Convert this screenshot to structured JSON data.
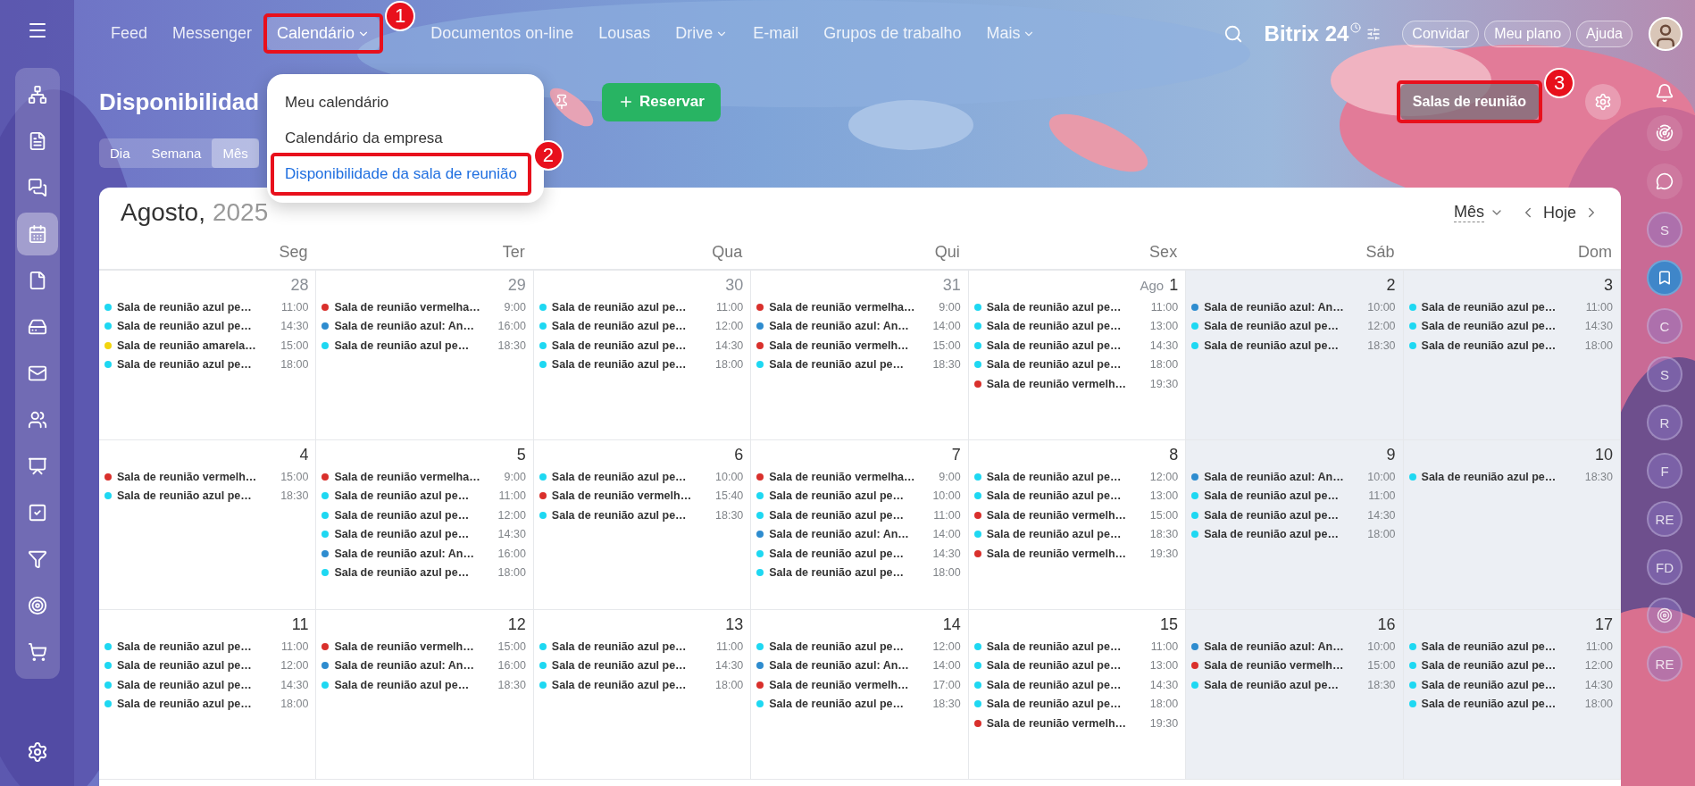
{
  "top_nav": {
    "items": [
      {
        "label": "Feed",
        "selected": false,
        "has_caret": false
      },
      {
        "label": "Messenger",
        "selected": false,
        "has_caret": false
      },
      {
        "label": "Calendário",
        "selected": true,
        "has_caret": true,
        "annotation": "1"
      },
      {
        "label": "Documentos on-line",
        "selected": false,
        "has_caret": false
      },
      {
        "label": "Lousas",
        "selected": false,
        "has_caret": false
      },
      {
        "label": "Drive",
        "selected": false,
        "has_caret": true
      },
      {
        "label": "E-mail",
        "selected": false,
        "has_caret": false
      },
      {
        "label": "Grupos de trabalho",
        "selected": false,
        "has_caret": false
      },
      {
        "label": "Mais",
        "selected": false,
        "has_caret": true
      }
    ],
    "logo": "Bitrix 24",
    "buttons": [
      "Convidar",
      "Meu plano",
      "Ajuda"
    ]
  },
  "dropdown": {
    "items": [
      {
        "label": "Meu calendário",
        "selected": false
      },
      {
        "label": "Calendário da empresa",
        "selected": false
      },
      {
        "label": "Disponibilidade da sala de reunião",
        "selected": true,
        "annotation": "2"
      }
    ]
  },
  "page": {
    "title": "Disponibilidad",
    "reserve_button": "Reservar",
    "rooms_button": {
      "label": "Salas de reunião",
      "annotation": "3"
    }
  },
  "view_tabs": [
    {
      "label": "Dia",
      "selected": false
    },
    {
      "label": "Semana",
      "selected": false
    },
    {
      "label": "Mês",
      "selected": true
    }
  ],
  "right_rail": [
    {
      "kind": "initials",
      "initials": "S"
    },
    {
      "kind": "bookmark"
    },
    {
      "kind": "initials",
      "initials": "C"
    },
    {
      "kind": "initials",
      "initials": "S"
    },
    {
      "kind": "initials",
      "initials": "R"
    },
    {
      "kind": "initials",
      "initials": "F"
    },
    {
      "kind": "initials",
      "initials": "RE"
    },
    {
      "kind": "initials",
      "initials": "FD"
    },
    {
      "kind": "target"
    },
    {
      "kind": "initials",
      "initials": "RE"
    }
  ],
  "calendar": {
    "month": "Agosto,",
    "year": "2025",
    "view_select": "Mês",
    "today": "Hoje",
    "weekdays": [
      {
        "label": "Seg",
        "weekend": false
      },
      {
        "label": "Ter",
        "weekend": false
      },
      {
        "label": "Qua",
        "weekend": false
      },
      {
        "label": "Qui",
        "weekend": false
      },
      {
        "label": "Sex",
        "weekend": false
      },
      {
        "label": "Sáb",
        "weekend": true
      },
      {
        "label": "Dom",
        "weekend": true
      }
    ],
    "weeks": [
      {
        "days": [
          {
            "day": "28",
            "other_month": true,
            "events": [
              {
                "title": "Sala de reunião azul pe…",
                "time": "11:00",
                "color": "#1ed8f2"
              },
              {
                "title": "Sala de reunião azul pe…",
                "time": "14:30",
                "color": "#1ed8f2"
              },
              {
                "title": "Sala de reunião amarela…",
                "time": "15:00",
                "color": "#f2d50f"
              },
              {
                "title": "Sala de reunião azul pe…",
                "time": "18:00",
                "color": "#1ed8f2"
              }
            ]
          },
          {
            "day": "29",
            "other_month": true,
            "events": [
              {
                "title": "Sala de reunião vermelha…",
                "time": "9:00",
                "color": "#d9302c"
              },
              {
                "title": "Sala de reunião azul: An…",
                "time": "16:00",
                "color": "#2e8ccf"
              },
              {
                "title": "Sala de reunião azul pe…",
                "time": "18:30",
                "color": "#1ed8f2"
              }
            ]
          },
          {
            "day": "30",
            "other_month": true,
            "events": [
              {
                "title": "Sala de reunião azul pe…",
                "time": "11:00",
                "color": "#1ed8f2"
              },
              {
                "title": "Sala de reunião azul pe…",
                "time": "12:00",
                "color": "#1ed8f2"
              },
              {
                "title": "Sala de reunião azul pe…",
                "time": "14:30",
                "color": "#1ed8f2"
              },
              {
                "title": "Sala de reunião azul pe…",
                "time": "18:00",
                "color": "#1ed8f2"
              }
            ]
          },
          {
            "day": "31",
            "other_month": true,
            "events": [
              {
                "title": "Sala de reunião vermelha…",
                "time": "9:00",
                "color": "#d9302c"
              },
              {
                "title": "Sala de reunião azul: An…",
                "time": "14:00",
                "color": "#2e8ccf"
              },
              {
                "title": "Sala de reunião vermelh…",
                "time": "15:00",
                "color": "#d9302c"
              },
              {
                "title": "Sala de reunião azul pe…",
                "time": "18:30",
                "color": "#1ed8f2"
              }
            ]
          },
          {
            "month_prefix": "Ago",
            "day": "1",
            "other_month": false,
            "events": [
              {
                "title": "Sala de reunião azul pe…",
                "time": "11:00",
                "color": "#1ed8f2"
              },
              {
                "title": "Sala de reunião azul pe…",
                "time": "13:00",
                "color": "#1ed8f2"
              },
              {
                "title": "Sala de reunião azul pe…",
                "time": "14:30",
                "color": "#1ed8f2"
              },
              {
                "title": "Sala de reunião azul pe…",
                "time": "18:00",
                "color": "#1ed8f2"
              },
              {
                "title": "Sala de reunião vermelh…",
                "time": "19:30",
                "color": "#d9302c"
              }
            ]
          },
          {
            "day": "2",
            "other_month": false,
            "events": [
              {
                "title": "Sala de reunião azul: An…",
                "time": "10:00",
                "color": "#2e8ccf"
              },
              {
                "title": "Sala de reunião azul pe…",
                "time": "12:00",
                "color": "#1ed8f2"
              },
              {
                "title": "Sala de reunião azul pe…",
                "time": "18:30",
                "color": "#1ed8f2"
              }
            ]
          },
          {
            "day": "3",
            "other_month": false,
            "events": [
              {
                "title": "Sala de reunião azul pe…",
                "time": "11:00",
                "color": "#1ed8f2"
              },
              {
                "title": "Sala de reunião azul pe…",
                "time": "14:30",
                "color": "#1ed8f2"
              },
              {
                "title": "Sala de reunião azul pe…",
                "time": "18:00",
                "color": "#1ed8f2"
              }
            ]
          }
        ]
      },
      {
        "days": [
          {
            "day": "4",
            "other_month": false,
            "events": [
              {
                "title": "Sala de reunião vermelh…",
                "time": "15:00",
                "color": "#d9302c"
              },
              {
                "title": "Sala de reunião azul pe…",
                "time": "18:30",
                "color": "#1ed8f2"
              }
            ]
          },
          {
            "day": "5",
            "other_month": false,
            "events": [
              {
                "title": "Sala de reunião vermelha…",
                "time": "9:00",
                "color": "#d9302c"
              },
              {
                "title": "Sala de reunião azul pe…",
                "time": "11:00",
                "color": "#1ed8f2"
              },
              {
                "title": "Sala de reunião azul pe…",
                "time": "12:00",
                "color": "#1ed8f2"
              },
              {
                "title": "Sala de reunião azul pe…",
                "time": "14:30",
                "color": "#1ed8f2"
              },
              {
                "title": "Sala de reunião azul: An…",
                "time": "16:00",
                "color": "#2e8ccf"
              },
              {
                "title": "Sala de reunião azul pe…",
                "time": "18:00",
                "color": "#1ed8f2"
              }
            ]
          },
          {
            "day": "6",
            "other_month": false,
            "events": [
              {
                "title": "Sala de reunião azul pe…",
                "time": "10:00",
                "color": "#1ed8f2"
              },
              {
                "title": "Sala de reunião vermelh…",
                "time": "15:40",
                "color": "#d9302c"
              },
              {
                "title": "Sala de reunião azul pe…",
                "time": "18:30",
                "color": "#1ed8f2"
              }
            ]
          },
          {
            "day": "7",
            "other_month": false,
            "events": [
              {
                "title": "Sala de reunião vermelha…",
                "time": "9:00",
                "color": "#d9302c"
              },
              {
                "title": "Sala de reunião azul pe…",
                "time": "10:00",
                "color": "#1ed8f2"
              },
              {
                "title": "Sala de reunião azul pe…",
                "time": "11:00",
                "color": "#1ed8f2"
              },
              {
                "title": "Sala de reunião azul: An…",
                "time": "14:00",
                "color": "#2e8ccf"
              },
              {
                "title": "Sala de reunião azul pe…",
                "time": "14:30",
                "color": "#1ed8f2"
              },
              {
                "title": "Sala de reunião azul pe…",
                "time": "18:00",
                "color": "#1ed8f2"
              }
            ]
          },
          {
            "day": "8",
            "other_month": false,
            "events": [
              {
                "title": "Sala de reunião azul pe…",
                "time": "12:00",
                "color": "#1ed8f2"
              },
              {
                "title": "Sala de reunião azul pe…",
                "time": "13:00",
                "color": "#1ed8f2"
              },
              {
                "title": "Sala de reunião vermelh…",
                "time": "15:00",
                "color": "#d9302c"
              },
              {
                "title": "Sala de reunião azul pe…",
                "time": "18:30",
                "color": "#1ed8f2"
              },
              {
                "title": "Sala de reunião vermelh…",
                "time": "19:30",
                "color": "#d9302c"
              }
            ]
          },
          {
            "day": "9",
            "other_month": false,
            "events": [
              {
                "title": "Sala de reunião azul: An…",
                "time": "10:00",
                "color": "#2e8ccf"
              },
              {
                "title": "Sala de reunião azul pe…",
                "time": "11:00",
                "color": "#1ed8f2"
              },
              {
                "title": "Sala de reunião azul pe…",
                "time": "14:30",
                "color": "#1ed8f2"
              },
              {
                "title": "Sala de reunião azul pe…",
                "time": "18:00",
                "color": "#1ed8f2"
              }
            ]
          },
          {
            "day": "10",
            "other_month": false,
            "events": [
              {
                "title": "Sala de reunião azul pe…",
                "time": "18:30",
                "color": "#1ed8f2"
              }
            ]
          }
        ]
      },
      {
        "days": [
          {
            "day": "11",
            "other_month": false,
            "events": [
              {
                "title": "Sala de reunião azul pe…",
                "time": "11:00",
                "color": "#1ed8f2"
              },
              {
                "title": "Sala de reunião azul pe…",
                "time": "12:00",
                "color": "#1ed8f2"
              },
              {
                "title": "Sala de reunião azul pe…",
                "time": "14:30",
                "color": "#1ed8f2"
              },
              {
                "title": "Sala de reunião azul pe…",
                "time": "18:00",
                "color": "#1ed8f2"
              }
            ]
          },
          {
            "day": "12",
            "other_month": false,
            "events": [
              {
                "title": "Sala de reunião vermelh…",
                "time": "15:00",
                "color": "#d9302c"
              },
              {
                "title": "Sala de reunião azul: An…",
                "time": "16:00",
                "color": "#2e8ccf"
              },
              {
                "title": "Sala de reunião azul pe…",
                "time": "18:30",
                "color": "#1ed8f2"
              }
            ]
          },
          {
            "day": "13",
            "other_month": false,
            "events": [
              {
                "title": "Sala de reunião azul pe…",
                "time": "11:00",
                "color": "#1ed8f2"
              },
              {
                "title": "Sala de reunião azul pe…",
                "time": "14:30",
                "color": "#1ed8f2"
              },
              {
                "title": "Sala de reunião azul pe…",
                "time": "18:00",
                "color": "#1ed8f2"
              }
            ]
          },
          {
            "day": "14",
            "other_month": false,
            "events": [
              {
                "title": "Sala de reunião azul pe…",
                "time": "12:00",
                "color": "#1ed8f2"
              },
              {
                "title": "Sala de reunião azul: An…",
                "time": "14:00",
                "color": "#2e8ccf"
              },
              {
                "title": "Sala de reunião vermelh…",
                "time": "17:00",
                "color": "#d9302c"
              },
              {
                "title": "Sala de reunião azul pe…",
                "time": "18:30",
                "color": "#1ed8f2"
              }
            ]
          },
          {
            "day": "15",
            "other_month": false,
            "events": [
              {
                "title": "Sala de reunião azul pe…",
                "time": "11:00",
                "color": "#1ed8f2"
              },
              {
                "title": "Sala de reunião azul pe…",
                "time": "13:00",
                "color": "#1ed8f2"
              },
              {
                "title": "Sala de reunião azul pe…",
                "time": "14:30",
                "color": "#1ed8f2"
              },
              {
                "title": "Sala de reunião azul pe…",
                "time": "18:00",
                "color": "#1ed8f2"
              },
              {
                "title": "Sala de reunião vermelh…",
                "time": "19:30",
                "color": "#d9302c"
              }
            ]
          },
          {
            "day": "16",
            "other_month": false,
            "events": [
              {
                "title": "Sala de reunião azul: An…",
                "time": "10:00",
                "color": "#2e8ccf"
              },
              {
                "title": "Sala de reunião vermelh…",
                "time": "15:00",
                "color": "#d9302c"
              },
              {
                "title": "Sala de reunião azul pe…",
                "time": "18:30",
                "color": "#1ed8f2"
              }
            ]
          },
          {
            "day": "17",
            "other_month": false,
            "events": [
              {
                "title": "Sala de reunião azul pe…",
                "time": "11:00",
                "color": "#1ed8f2"
              },
              {
                "title": "Sala de reunião azul pe…",
                "time": "12:00",
                "color": "#1ed8f2"
              },
              {
                "title": "Sala de reunião azul pe…",
                "time": "14:30",
                "color": "#1ed8f2"
              },
              {
                "title": "Sala de reunião azul pe…",
                "time": "18:00",
                "color": "#1ed8f2"
              }
            ]
          }
        ]
      }
    ]
  }
}
